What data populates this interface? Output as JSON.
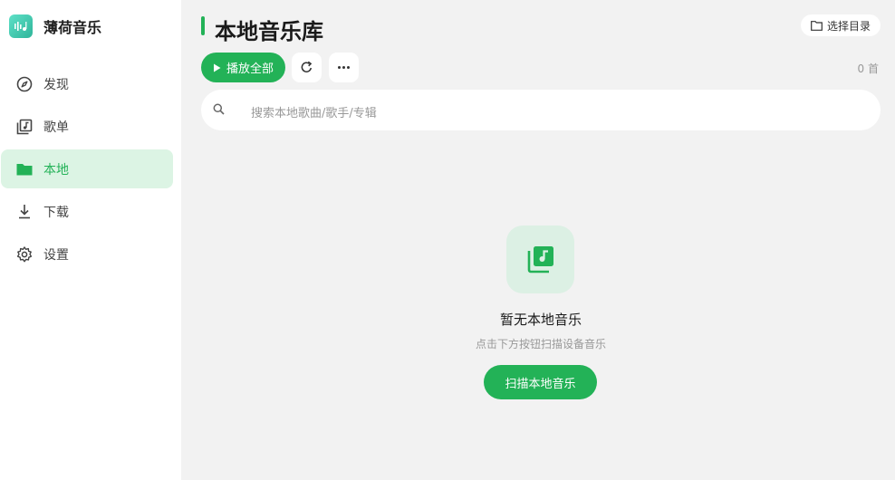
{
  "app": {
    "name": "薄荷音乐"
  },
  "sidebar": {
    "items": [
      {
        "label": "发现",
        "icon": "compass-icon",
        "active": false
      },
      {
        "label": "歌单",
        "icon": "playlist-icon",
        "active": false
      },
      {
        "label": "本地",
        "icon": "folder-icon",
        "active": true
      },
      {
        "label": "下载",
        "icon": "download-icon",
        "active": false
      },
      {
        "label": "设置",
        "icon": "gear-icon",
        "active": false
      }
    ]
  },
  "header": {
    "title": "本地音乐库",
    "select_dir_label": "选择目录"
  },
  "toolbar": {
    "play_all_label": "播放全部",
    "count_label": "0 首"
  },
  "search": {
    "placeholder": "搜索本地歌曲/歌手/专辑"
  },
  "empty_state": {
    "title": "暂无本地音乐",
    "subtitle": "点击下方按钮扫描设备音乐",
    "scan_button_label": "扫描本地音乐"
  },
  "colors": {
    "accent": "#23b257",
    "accent_light": "#dcf4e4",
    "background": "#f2f2f2"
  }
}
